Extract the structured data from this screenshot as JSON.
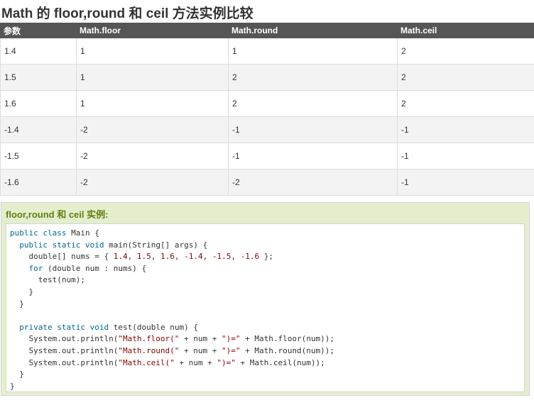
{
  "page": {
    "title": "Math 的 floor,round 和 ceil 方法实例比较"
  },
  "table": {
    "headers": [
      "参数",
      "Math.floor",
      "Math.round",
      "Math.ceil"
    ],
    "rows": [
      [
        "1.4",
        "1",
        "1",
        "2"
      ],
      [
        "1.5",
        "1",
        "2",
        "2"
      ],
      [
        "1.6",
        "1",
        "2",
        "2"
      ],
      [
        "-1.4",
        "-2",
        "-1",
        "-1"
      ],
      [
        "-1.5",
        "-2",
        "-1",
        "-1"
      ],
      [
        "-1.6",
        "-2",
        "-2",
        "-1"
      ]
    ]
  },
  "example": {
    "title": "floor,round 和 ceil 实例:",
    "code_lines": [
      "public class Main {",
      "  public static void main(String[] args) {",
      "    double[] nums = { 1.4, 1.5, 1.6, -1.4, -1.5, -1.6 };",
      "    for (double num : nums) {",
      "      test(num);",
      "    }",
      "  }",
      "",
      "  private static void test(double num) {",
      "    System.out.println(\"Math.floor(\" + num + \")=\" + Math.floor(num));",
      "    System.out.println(\"Math.round(\" + num + \")=\" + Math.round(num));",
      "    System.out.println(\"Math.ceil(\" + num + \")=\" + Math.ceil(num));",
      "  }",
      "}"
    ]
  },
  "colors": {
    "header_bg": "#555555",
    "example_bg": "#e5eecc",
    "example_title": "#617f10"
  }
}
